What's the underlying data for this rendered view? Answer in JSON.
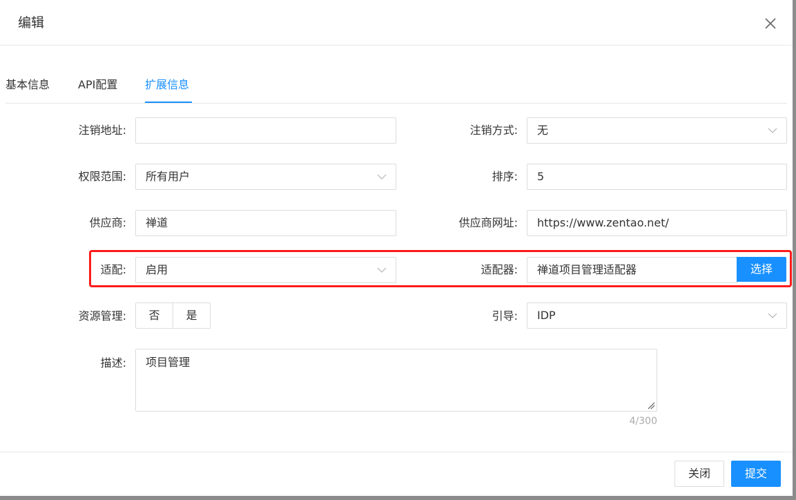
{
  "dialog": {
    "title": "编辑"
  },
  "tabs": [
    {
      "label": "基本信息",
      "active": false
    },
    {
      "label": "API配置",
      "active": false
    },
    {
      "label": "扩展信息",
      "active": true
    }
  ],
  "form": {
    "logout_url": {
      "label": "注销地址:",
      "value": ""
    },
    "logout_method": {
      "label": "注销方式:",
      "value": "无"
    },
    "permission_scope": {
      "label": "权限范围:",
      "value": "所有用户"
    },
    "sort": {
      "label": "排序:",
      "value": "5"
    },
    "vendor": {
      "label": "供应商:",
      "value": "禅道"
    },
    "vendor_url": {
      "label": "供应商网址:",
      "value": "https://www.zentao.net/"
    },
    "adapt": {
      "label": "适配:",
      "value": "启用"
    },
    "adapter": {
      "label": "适配器:",
      "value": "禅道项目管理适配器",
      "button": "选择"
    },
    "resource_management": {
      "label": "资源管理:",
      "options": [
        "否",
        "是"
      ]
    },
    "guide": {
      "label": "引导:",
      "value": "IDP"
    },
    "description": {
      "label": "描述:",
      "value": "项目管理",
      "counter": "4/300"
    }
  },
  "footer": {
    "close_label": "关闭",
    "submit_label": "提交"
  },
  "colors": {
    "accent": "#1890ff",
    "highlight": "#ff1a1a",
    "border": "#dcdcdc"
  },
  "icons": {
    "close": "close-icon",
    "select_arrow": "chevron-down-icon",
    "resize": "resize-handle-icon"
  }
}
